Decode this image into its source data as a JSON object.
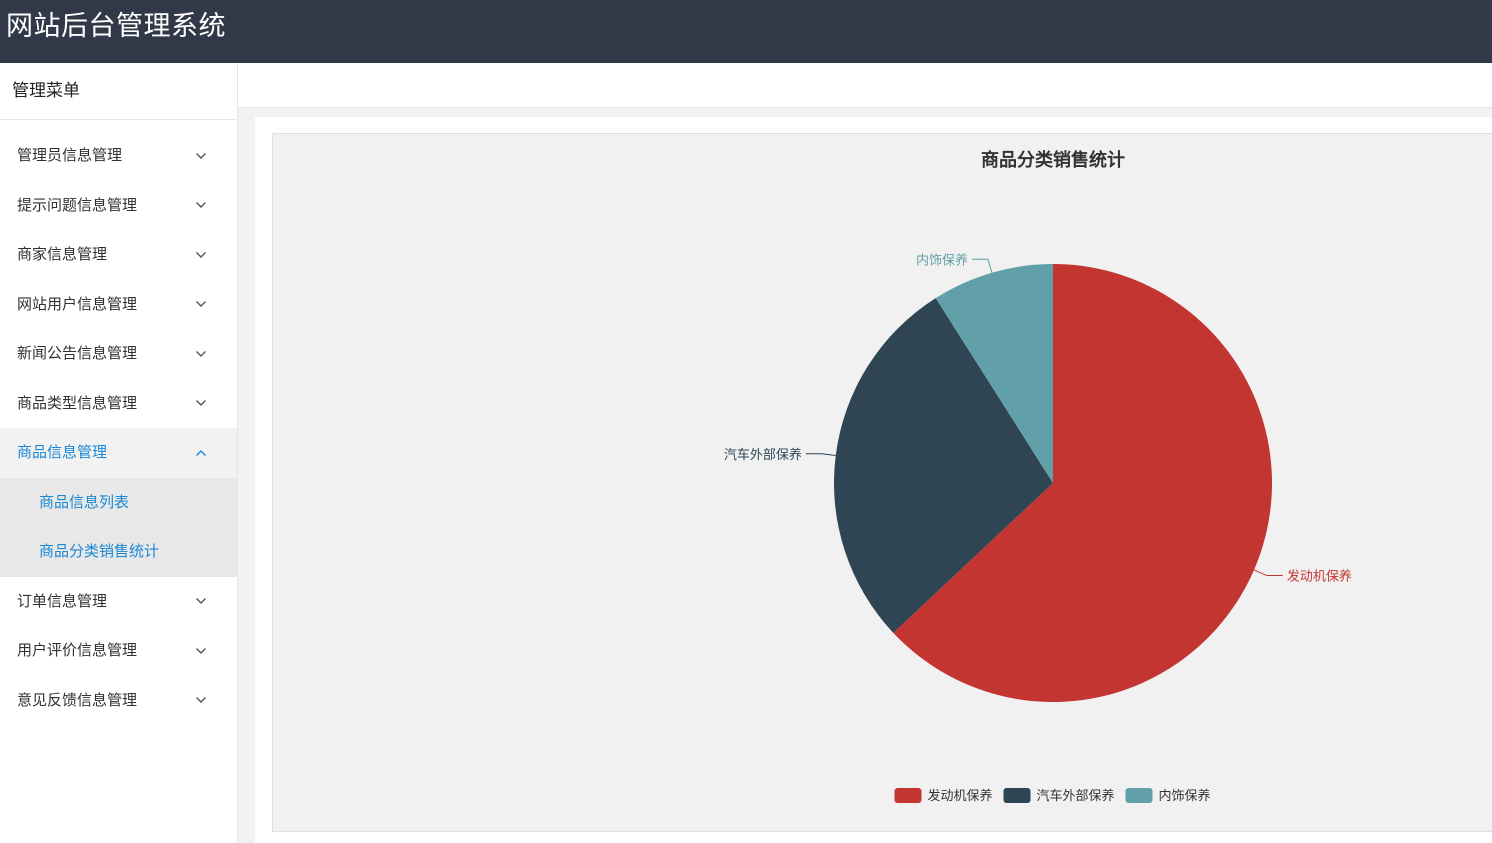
{
  "app": {
    "title": "网站后台管理系统"
  },
  "sidebar": {
    "title": "管理菜单",
    "items": [
      {
        "label": "管理员信息管理",
        "open": false
      },
      {
        "label": "提示问题信息管理",
        "open": false
      },
      {
        "label": "商家信息管理",
        "open": false
      },
      {
        "label": "网站用户信息管理",
        "open": false
      },
      {
        "label": "新闻公告信息管理",
        "open": false
      },
      {
        "label": "商品类型信息管理",
        "open": false
      },
      {
        "label": "商品信息管理",
        "open": true,
        "children": [
          "商品信息列表",
          "商品分类销售统计"
        ]
      },
      {
        "label": "订单信息管理",
        "open": false
      },
      {
        "label": "用户评价信息管理",
        "open": false
      },
      {
        "label": "意见反馈信息管理",
        "open": false
      }
    ]
  },
  "colors": {
    "topbar": "#313848",
    "active": "#1a88d6"
  },
  "chart_data": {
    "type": "pie",
    "title": "商品分类销售统计",
    "categories": [
      "发动机保养",
      "汽车外部保养",
      "内饰保养"
    ],
    "values": [
      63,
      28,
      9
    ],
    "colors": [
      "#c23531",
      "#2f4554",
      "#61a0a8"
    ],
    "legend": "bottom-center"
  }
}
